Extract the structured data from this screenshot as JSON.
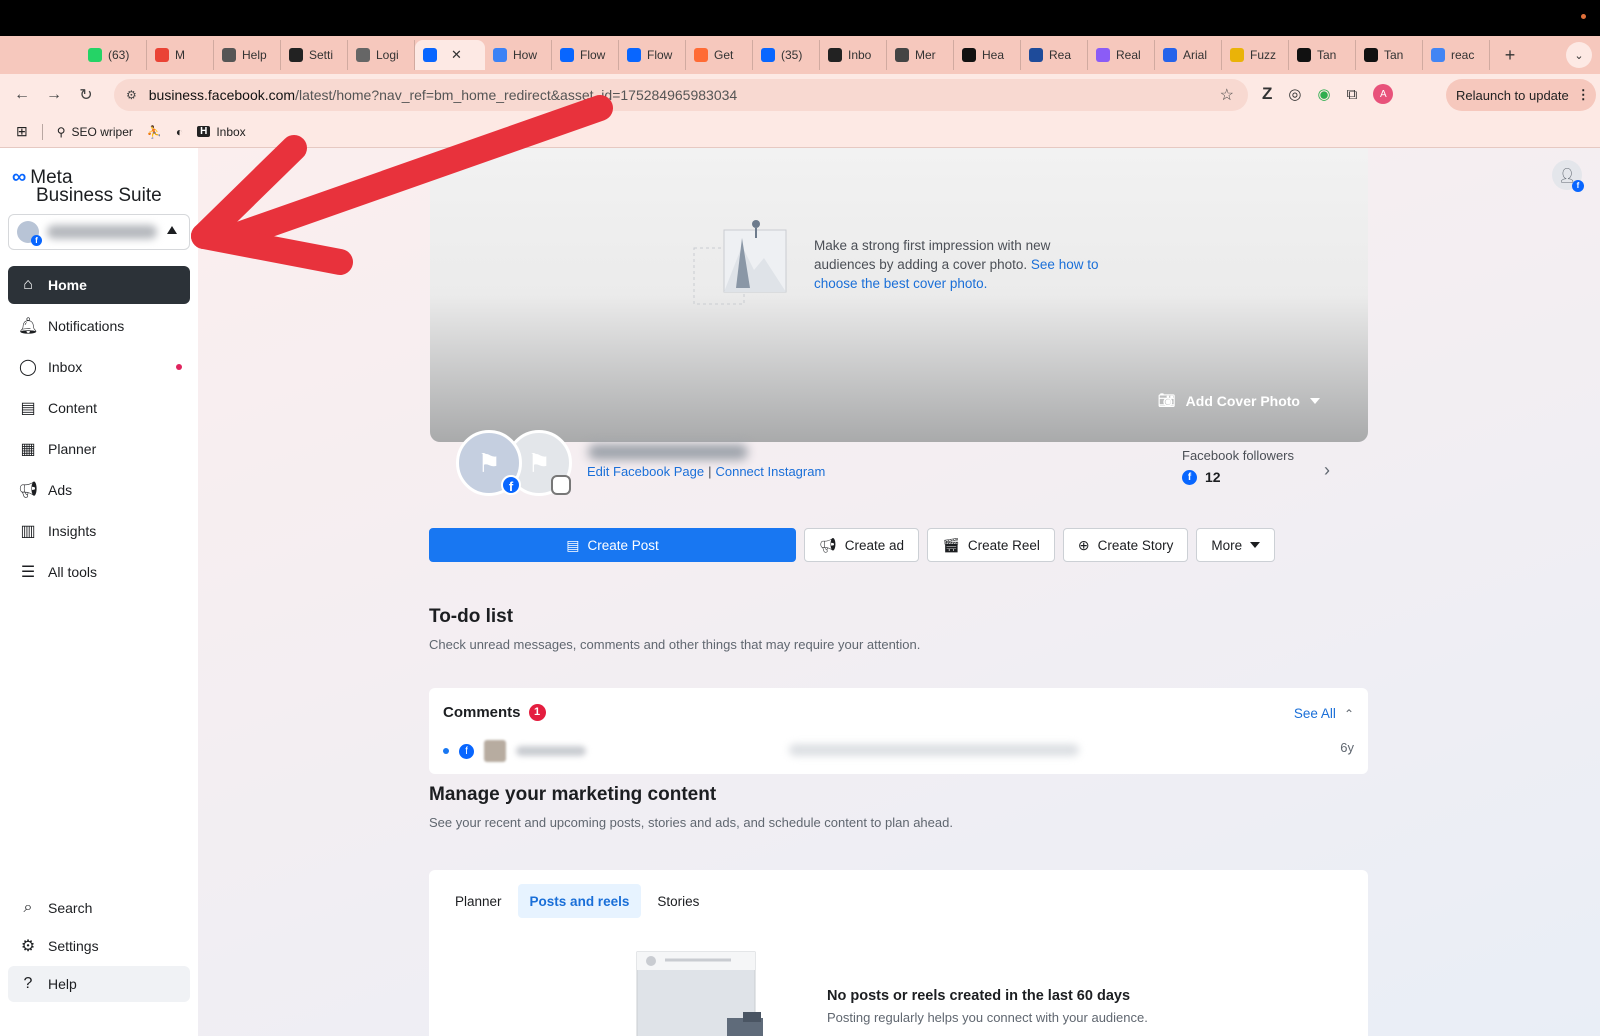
{
  "browser": {
    "tabs": [
      {
        "label": "(63)",
        "icon": "whatsapp-icon",
        "color": "#25d366"
      },
      {
        "label": "M",
        "icon": "gmail-icon",
        "color": "#ea4335"
      },
      {
        "label": "Help",
        "icon": "help-site-icon",
        "color": "#555555"
      },
      {
        "label": "Setti",
        "icon": "h-site-icon",
        "color": "#222222"
      },
      {
        "label": "Logi",
        "icon": "m-site-icon",
        "color": "#666666"
      },
      {
        "label": "",
        "icon": "meta-icon",
        "color": "#0866ff",
        "active": true
      },
      {
        "label": "How",
        "icon": "page-icon",
        "color": "#3b82f6"
      },
      {
        "label": "Flow",
        "icon": "meta-icon",
        "color": "#0866ff"
      },
      {
        "label": "Flow",
        "icon": "facebook-icon",
        "color": "#0866ff"
      },
      {
        "label": "Get",
        "icon": "get-icon",
        "color": "#ff6b35"
      },
      {
        "label": "(35)",
        "icon": "meta-icon",
        "color": "#0866ff"
      },
      {
        "label": "Inbo",
        "icon": "h-site-icon",
        "color": "#222222"
      },
      {
        "label": "Mer",
        "icon": "globe-icon",
        "color": "#444444"
      },
      {
        "label": "Hea",
        "icon": "m-site-icon",
        "color": "#111111"
      },
      {
        "label": "Rea",
        "icon": "h-site-icon",
        "color": "#1e4b9a"
      },
      {
        "label": "Real",
        "icon": "framer-icon",
        "color": "#8b5cf6"
      },
      {
        "label": "Arial",
        "icon": "c-site-icon",
        "color": "#2563eb"
      },
      {
        "label": "Fuzz",
        "icon": "fuzzy-icon",
        "color": "#eab308"
      },
      {
        "label": "Tan",
        "icon": "github-icon",
        "color": "#111111"
      },
      {
        "label": "Tan",
        "icon": "github-icon",
        "color": "#111111"
      },
      {
        "label": "reac",
        "icon": "google-icon",
        "color": "#4285f4"
      }
    ],
    "new_tab": "+",
    "url_host": "business.facebook.com",
    "url_path": "/latest/home?nav_ref=bm_home_redirect&asset_id=175284965983034",
    "relaunch_label": "Relaunch to update",
    "profile_initial": "A",
    "bookmarks": [
      {
        "label": "SEO wriper",
        "icon": "seo-icon"
      },
      {
        "label": "",
        "icon": "figure-icon"
      },
      {
        "label": "",
        "icon": "globe-icon"
      },
      {
        "label": "Inbox",
        "icon": "h-site-icon"
      }
    ]
  },
  "sidebar": {
    "logo_meta": "Meta",
    "logo_suite": "Business Suite",
    "items": [
      {
        "label": "Home",
        "icon": "home-icon",
        "active": true
      },
      {
        "label": "Notifications",
        "icon": "bell-icon"
      },
      {
        "label": "Inbox",
        "icon": "chat-bubble-icon",
        "unread": true
      },
      {
        "label": "Content",
        "icon": "content-icon"
      },
      {
        "label": "Planner",
        "icon": "calendar-grid-icon"
      },
      {
        "label": "Ads",
        "icon": "megaphone-icon"
      },
      {
        "label": "Insights",
        "icon": "bar-chart-icon"
      },
      {
        "label": "All tools",
        "icon": "menu-icon"
      }
    ],
    "bottom_items": [
      {
        "label": "Search",
        "icon": "search-icon"
      },
      {
        "label": "Settings",
        "icon": "gear-icon"
      },
      {
        "label": "Help",
        "icon": "question-icon"
      }
    ]
  },
  "main": {
    "cover_prompt": "Make a strong first impression with new audiences by adding a cover photo.",
    "cover_link": "See how to choose the best cover photo.",
    "add_cover_label": "Add Cover Photo",
    "edit_page_link": "Edit Facebook Page",
    "link_separator": "|",
    "connect_instagram_link": "Connect Instagram",
    "followers_label": "Facebook followers",
    "followers_count": "12",
    "actions": {
      "create_post": "Create Post",
      "create_ad": "Create ad",
      "create_reel": "Create Reel",
      "create_story": "Create Story",
      "more": "More"
    },
    "todo_title": "To-do list",
    "todo_sub": "Check unread messages, comments and other things that may require your attention.",
    "comments_title": "Comments",
    "comments_count": "1",
    "see_all": "See All",
    "comment_age": "6y",
    "marketing_title": "Manage your marketing content",
    "marketing_sub": "See your recent and upcoming posts, stories and ads, and schedule content to plan ahead.",
    "content_tabs": [
      {
        "label": "Planner"
      },
      {
        "label": "Posts and reels",
        "active": true
      },
      {
        "label": "Stories"
      }
    ],
    "empty_title": "No posts or reels created in the last 60 days",
    "empty_sub": "Posting regularly helps you connect with your audience."
  },
  "colors": {
    "accent": "#1877f2",
    "annotation_arrow": "#e8323c",
    "active_nav": "#2c3238"
  }
}
